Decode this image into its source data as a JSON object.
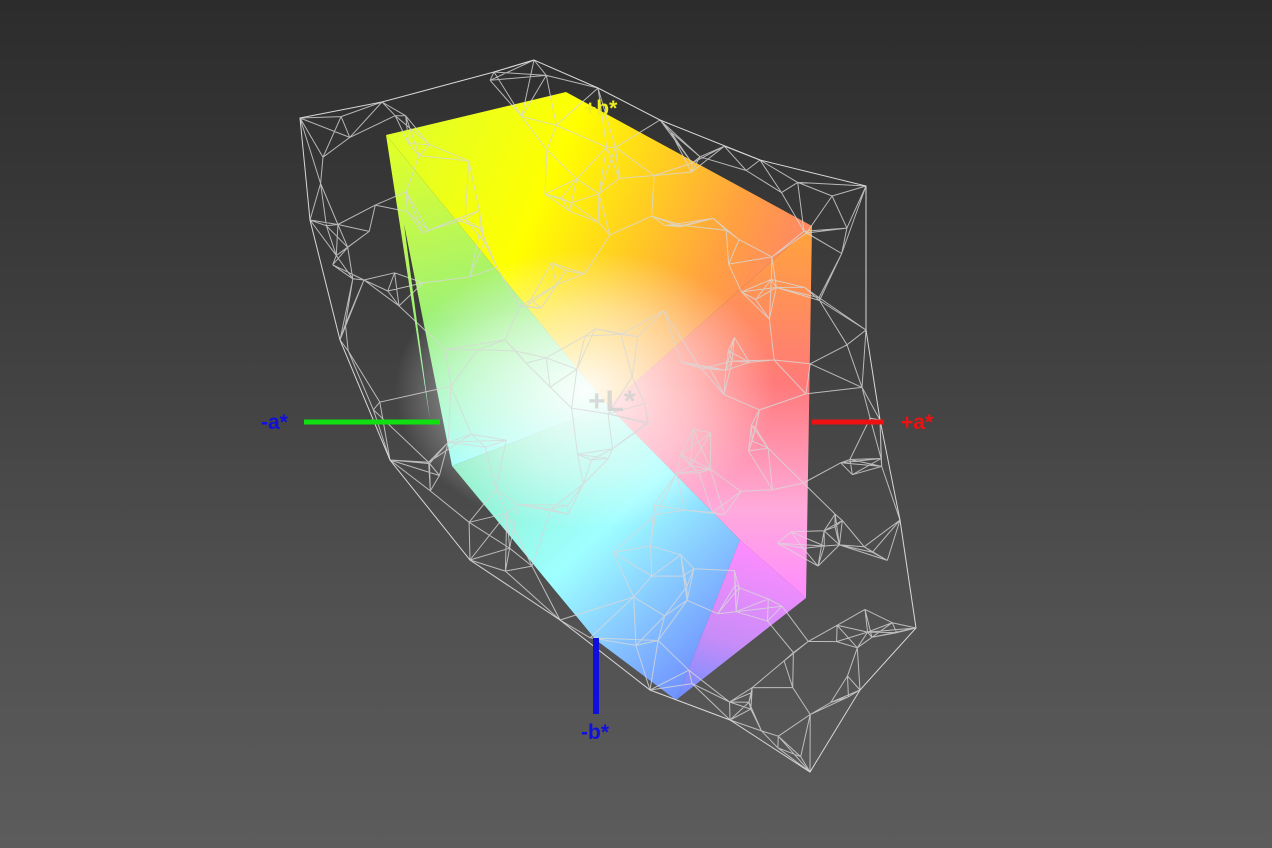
{
  "axes": {
    "neg_a": {
      "label": "-a*",
      "color": "#1010dd",
      "line_color": "#10e010"
    },
    "pos_a": {
      "label": "+a*",
      "color": "#ee1111",
      "line_color": "#ee1111"
    },
    "pos_b": {
      "label": "+b*",
      "color": "#eeee22",
      "line_color": "#eeee22"
    },
    "neg_b": {
      "label": "-b*",
      "color": "#1010dd",
      "line_color": "#1010dd"
    },
    "l": {
      "label": "+L*",
      "color": "#cfcfcf"
    }
  },
  "gamut": {
    "colors": {
      "yellow": "#ffff00",
      "yellow_green": "#dfff2a",
      "green": "#9af07a",
      "cyan": "#9effff",
      "aqua_green": "#8ef0c8",
      "blue": "#6f8fff",
      "violet": "#c88cf8",
      "magenta": "#ff8cff",
      "pink": "#ffaadc",
      "red": "#ff7a7a",
      "orange": "#ffa040",
      "white": "#ffffff",
      "wire": "#d8d8d8"
    }
  }
}
